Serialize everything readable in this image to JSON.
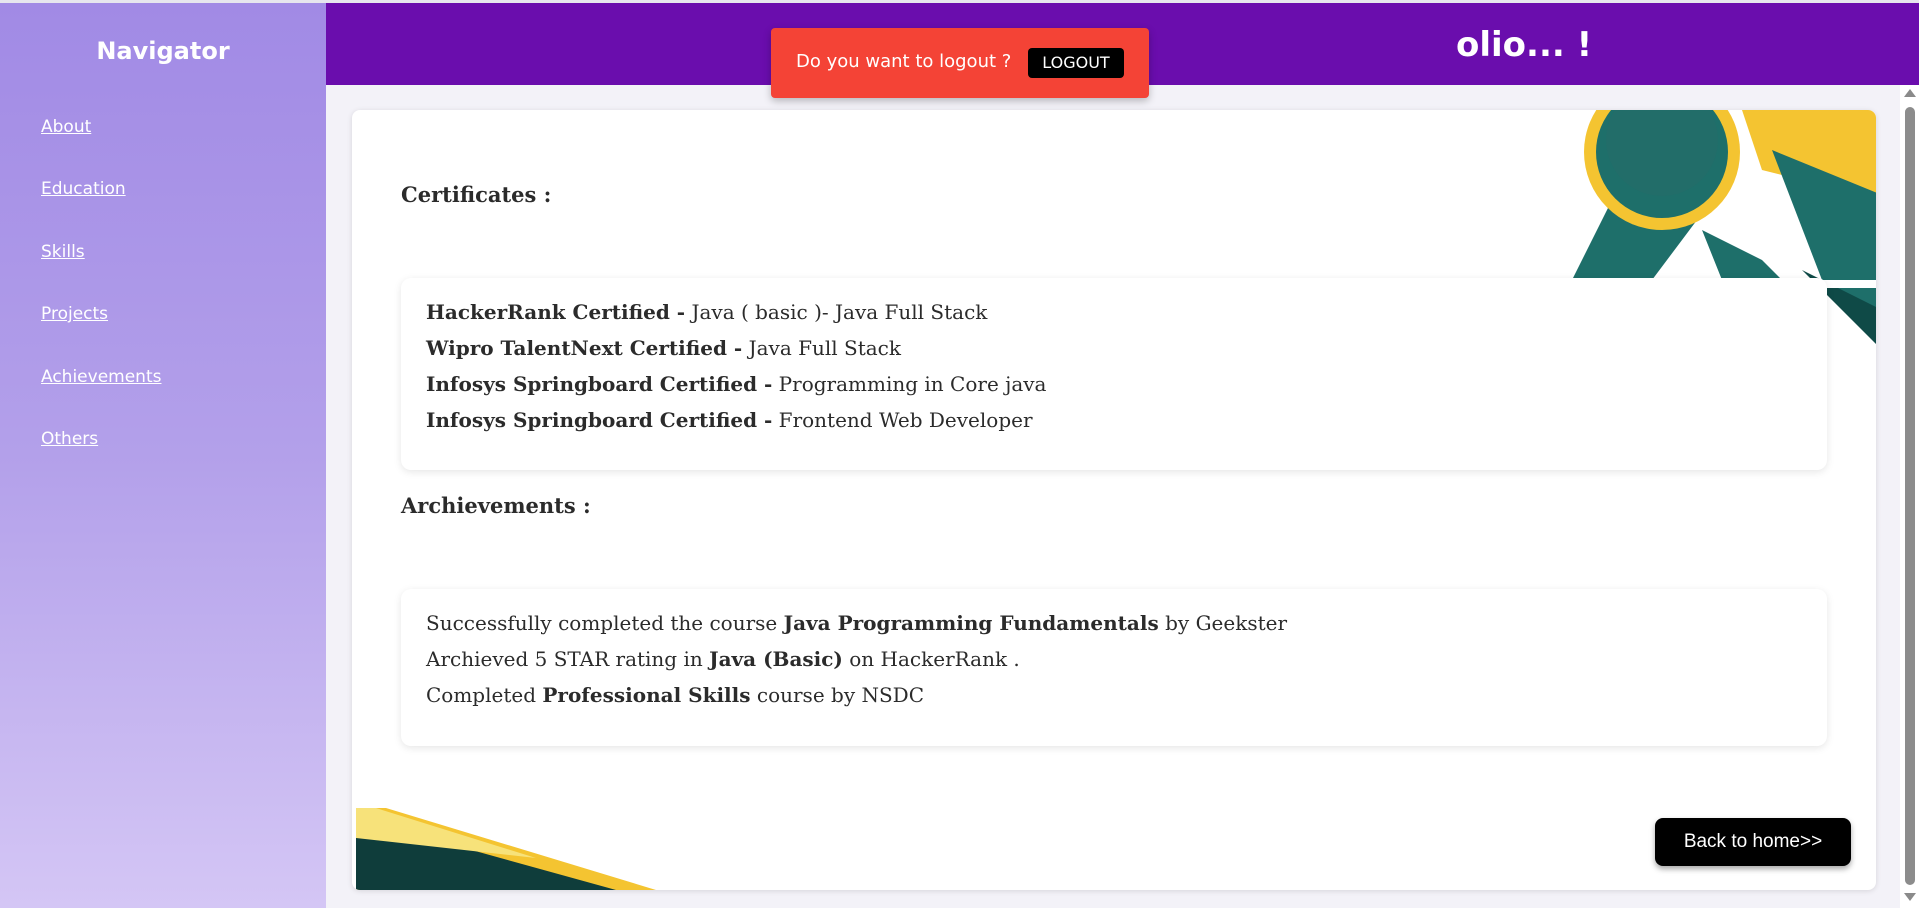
{
  "sidebar": {
    "title": "Navigator",
    "items": [
      {
        "label": "About"
      },
      {
        "label": "Education"
      },
      {
        "label": "Skills"
      },
      {
        "label": "Projects"
      },
      {
        "label": "Achievements"
      },
      {
        "label": "Others"
      }
    ]
  },
  "header": {
    "title_visible": "olio... !"
  },
  "toast": {
    "message": "Do you want to logout ?",
    "button_label": "LOGOUT"
  },
  "certificates": {
    "heading": "Certificates :",
    "items": [
      {
        "bold": "HackerRank Certified -",
        "text": " Java ( basic )- Java Full Stack"
      },
      {
        "bold": "Wipro TalentNext Certified -",
        "text": " Java Full Stack"
      },
      {
        "bold": "Infosys Springboard Certified -",
        "text": " Programming in Core java"
      },
      {
        "bold": "Infosys Springboard Certified -",
        "text": " Frontend Web Developer"
      }
    ]
  },
  "achievements": {
    "heading": "Archievements :",
    "items": [
      {
        "pre": "Successfully completed the course ",
        "bold": "Java Programming Fundamentals",
        "post": " by Geekster"
      },
      {
        "pre": "Archieved 5 STAR rating in ",
        "bold": "Java (Basic)",
        "post": " on HackerRank ."
      },
      {
        "pre": "Completed ",
        "bold": "Professional Skills",
        "post": " course by NSDC"
      }
    ]
  },
  "back_button": {
    "label": "Back to home>>"
  },
  "colors": {
    "header": "#6a0dad",
    "toast": "#f44336",
    "sidebar_top": "#a18ae5",
    "sidebar_bottom": "#d4c6f5"
  }
}
